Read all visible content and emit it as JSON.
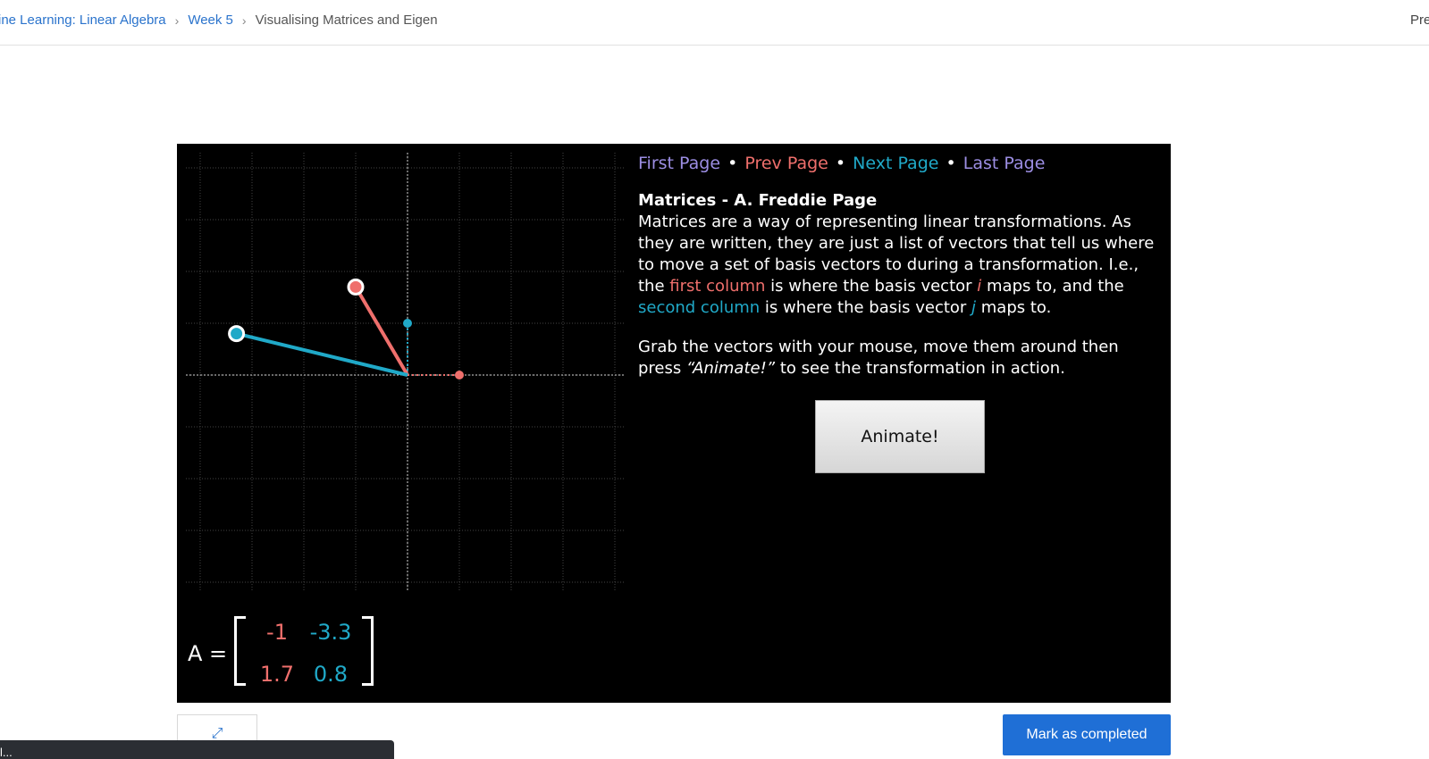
{
  "breadcrumb": {
    "course": "ine Learning: Linear Algebra",
    "week": "Week 5",
    "current": "Visualising Matrices and Eigen"
  },
  "header": {
    "right_text": "Pre"
  },
  "nav": {
    "first": "First Page",
    "prev": "Prev Page",
    "next": "Next Page",
    "last": "Last Page",
    "separator": "•"
  },
  "content": {
    "title": "Matrices - A. Freddie Page",
    "p1_a": "Matrices are a way of representing linear transformations. As they are written, they are just a list of vectors that tell us where to move a set of basis vectors to during a transformation. I.e., the ",
    "first_column": "first column",
    "p1_b": " is where the basis vector ",
    "i": "i",
    "p1_c": " maps to, and the ",
    "second_column": "second column",
    "p1_d": " is where the basis vector ",
    "j": "j",
    "p1_e": " maps to.",
    "p2_a": "Grab the vectors with your mouse, move them around then press ",
    "animate_quote": "“Animate!”",
    "p2_b": " to see the transformation in action."
  },
  "animate_button": "Animate!",
  "matrix": {
    "label": "A =",
    "a11": "-1",
    "a12": "-3.3",
    "a21": "1.7",
    "a22": "0.8"
  },
  "vectors": {
    "i_hat": [
      -1,
      1.7
    ],
    "j_hat": [
      -3.3,
      0.8
    ]
  },
  "colors": {
    "red": "#ef6f6c",
    "cyan": "#20a9c8",
    "purple": "#9c8ee3",
    "primary_blue": "#1f6fd6"
  },
  "icons": {
    "expand": "expand-icon"
  },
  "footer": {
    "complete_button": "Mark as completed",
    "toast_text": "l..."
  }
}
